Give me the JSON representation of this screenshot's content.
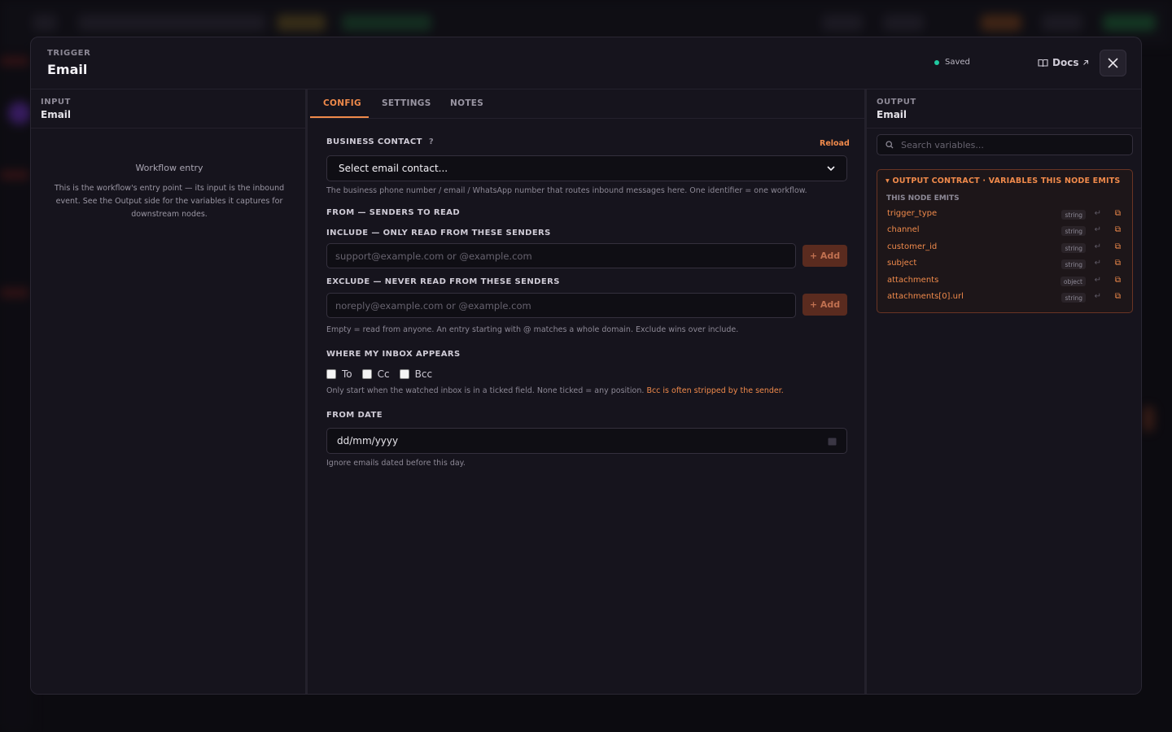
{
  "header": {
    "kicker": "TRIGGER",
    "title": "Email",
    "status": "Saved",
    "docs_label": "Docs",
    "status_color": "#20c9a0"
  },
  "input_pane": {
    "kicker": "INPUT",
    "title": "Email",
    "entry_title": "Workflow entry",
    "entry_desc": "This is the workflow's entry point — its input is the inbound event. See the Output side for the variables it captures for downstream nodes."
  },
  "tabs": [
    {
      "label": "CONFIG",
      "active": true
    },
    {
      "label": "SETTINGS",
      "active": false
    },
    {
      "label": "NOTES",
      "active": false
    }
  ],
  "config": {
    "business_contact_label": "BUSINESS CONTACT",
    "help_mark": "?",
    "reload_label": "Reload",
    "contact_select_value": "Select email contact...",
    "contact_hint": "The business phone number / email / WhatsApp number that routes inbound messages here. One identifier = one workflow.",
    "from_section": "FROM — SENDERS TO READ",
    "include_label": "INCLUDE — ONLY READ FROM THESE SENDERS",
    "include_placeholder": "support@example.com or @example.com",
    "exclude_label": "EXCLUDE — NEVER READ FROM THESE SENDERS",
    "exclude_placeholder": "noreply@example.com or @example.com",
    "add_label": "+ Add",
    "senders_hint": "Empty = read from anyone. An entry starting with @ matches a whole domain. Exclude wins over include.",
    "inbox_label": "WHERE MY INBOX APPEARS",
    "checkboxes": [
      {
        "label": "To",
        "checked": false
      },
      {
        "label": "Cc",
        "checked": false
      },
      {
        "label": "Bcc",
        "checked": false
      }
    ],
    "inbox_hint": "Only start when the watched inbox is in a ticked field. None ticked = any position.",
    "inbox_warning": "Bcc is often stripped by the sender.",
    "from_date_label": "FROM DATE",
    "date_value": "dd/mm/yyyy",
    "date_hint": "Ignore emails dated before this day."
  },
  "output_pane": {
    "kicker": "OUTPUT",
    "title": "Email",
    "search_placeholder": "Search variables...",
    "contract_title": "▾ OUTPUT CONTRACT · VARIABLES THIS NODE EMITS",
    "contract_sub": "THIS NODE EMITS",
    "variables": [
      {
        "name": "trigger_type",
        "type": "string"
      },
      {
        "name": "channel",
        "type": "string"
      },
      {
        "name": "customer_id",
        "type": "string"
      },
      {
        "name": "subject",
        "type": "string"
      },
      {
        "name": "attachments",
        "type": "object"
      },
      {
        "name": "attachments[0].url",
        "type": "string"
      }
    ]
  },
  "colors": {
    "accent": "#f08a4b",
    "panel": "#16141d",
    "background": "#0c0b10"
  }
}
